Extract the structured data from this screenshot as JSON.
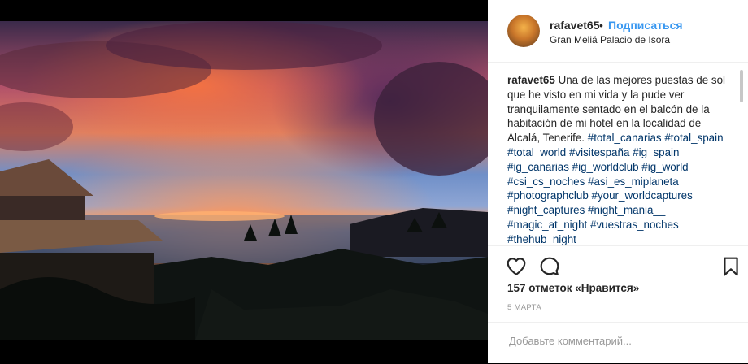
{
  "post": {
    "username": "rafavet65",
    "separator": "•",
    "follow_label": "Подписаться",
    "location": "Gran Meliá Palacio de Isora"
  },
  "caption": {
    "username": "rafavet65",
    "text": "Una de las mejores puestas de sol que he visto en mi vida y la pude ver tranquilamente sentado en el balcón de la habitación de mi hotel en la localidad de Alcalá, Tenerife.",
    "hashtags": [
      "#total_canarias",
      "#total_spain",
      "#total_world",
      "#visitespaña",
      "#ig_spain",
      "#ig_canarias",
      "#ig_worldclub",
      "#ig_world",
      "#csi_cs_noches",
      "#asi_es_miplaneta",
      "#photographclub",
      "#your_worldcaptures",
      "#night_captures",
      "#night_mania__",
      "#magic_at_night",
      "#vuestras_noches",
      "#thehub_night"
    ]
  },
  "actions": {
    "like_icon": "heart-icon",
    "comment_icon": "comment-icon",
    "save_icon": "bookmark-icon"
  },
  "likes_text": "157 отметок «Нравится»",
  "date_text": "5 марта",
  "comment_placeholder": "Добавьте комментарий...",
  "colors": {
    "link": "#3897f0",
    "hashtag": "#003569",
    "text": "#262626",
    "muted": "#999999"
  }
}
